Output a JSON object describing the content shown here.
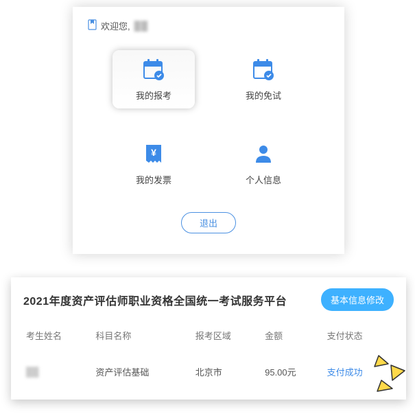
{
  "welcome": {
    "prefix": "欢迎您,",
    "name": "██"
  },
  "tiles": [
    {
      "label": "我的报考",
      "icon": "calendar-check-icon",
      "selected": true
    },
    {
      "label": "我的免试",
      "icon": "calendar-check-icon",
      "selected": false
    },
    {
      "label": "我的发票",
      "icon": "receipt-icon",
      "selected": false
    },
    {
      "label": "个人信息",
      "icon": "user-icon",
      "selected": false
    }
  ],
  "logout_label": "退出",
  "platform": {
    "title": "2021年度资产评估师职业资格全国统一考试服务平台",
    "edit_btn": "基本信息修改",
    "columns": [
      "考生姓名",
      "科目名称",
      "报考区域",
      "金额",
      "支付状态"
    ],
    "rows": [
      {
        "name": "██",
        "subject": "资产评估基础",
        "region": "北京市",
        "amount": "95.00元",
        "status": "支付成功"
      }
    ]
  }
}
